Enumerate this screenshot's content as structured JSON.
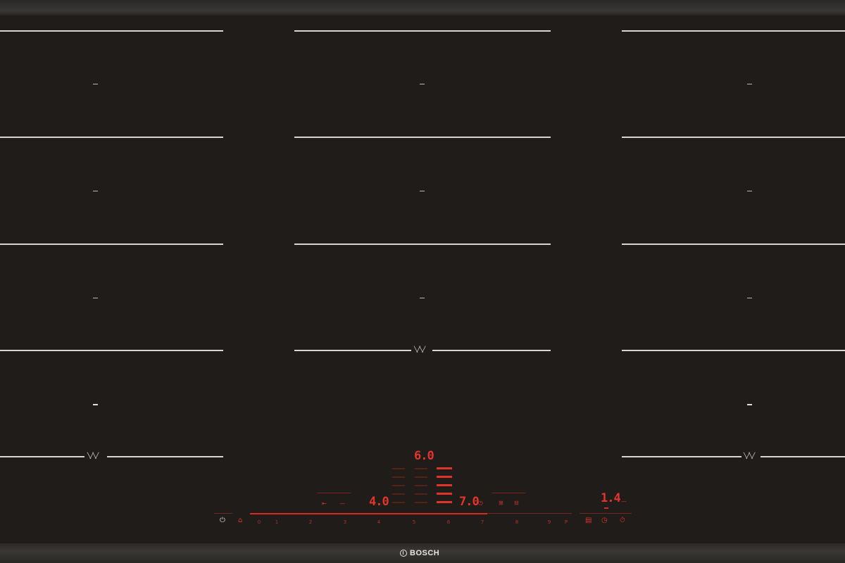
{
  "brand": {
    "name": "BOSCH"
  },
  "cooking_zones": {
    "zone_marker": "—",
    "flex_indicator": "╲╱╲╱"
  },
  "control_panel": {
    "center_display": {
      "value": "6.0"
    },
    "left_display": {
      "value": "4.0"
    },
    "middle_display": {
      "value": "7.0"
    },
    "right_display": {
      "value": "1.4"
    },
    "left_aux_labels": [
      "⇤",
      "—"
    ],
    "middle_aux_label": "◷",
    "right_aux_labels": [
      "⊞",
      "⊟"
    ],
    "right_small_label": "—",
    "power_button_label": "⏻",
    "lock_button_label": "⌂",
    "power_scale": [
      "0",
      "1",
      "2",
      "3",
      "4",
      "5",
      "6",
      "7",
      "8",
      "9",
      "P"
    ],
    "right_buttons": [
      "▤",
      "◷",
      "⏱"
    ],
    "accent_color": "#e0302a"
  }
}
